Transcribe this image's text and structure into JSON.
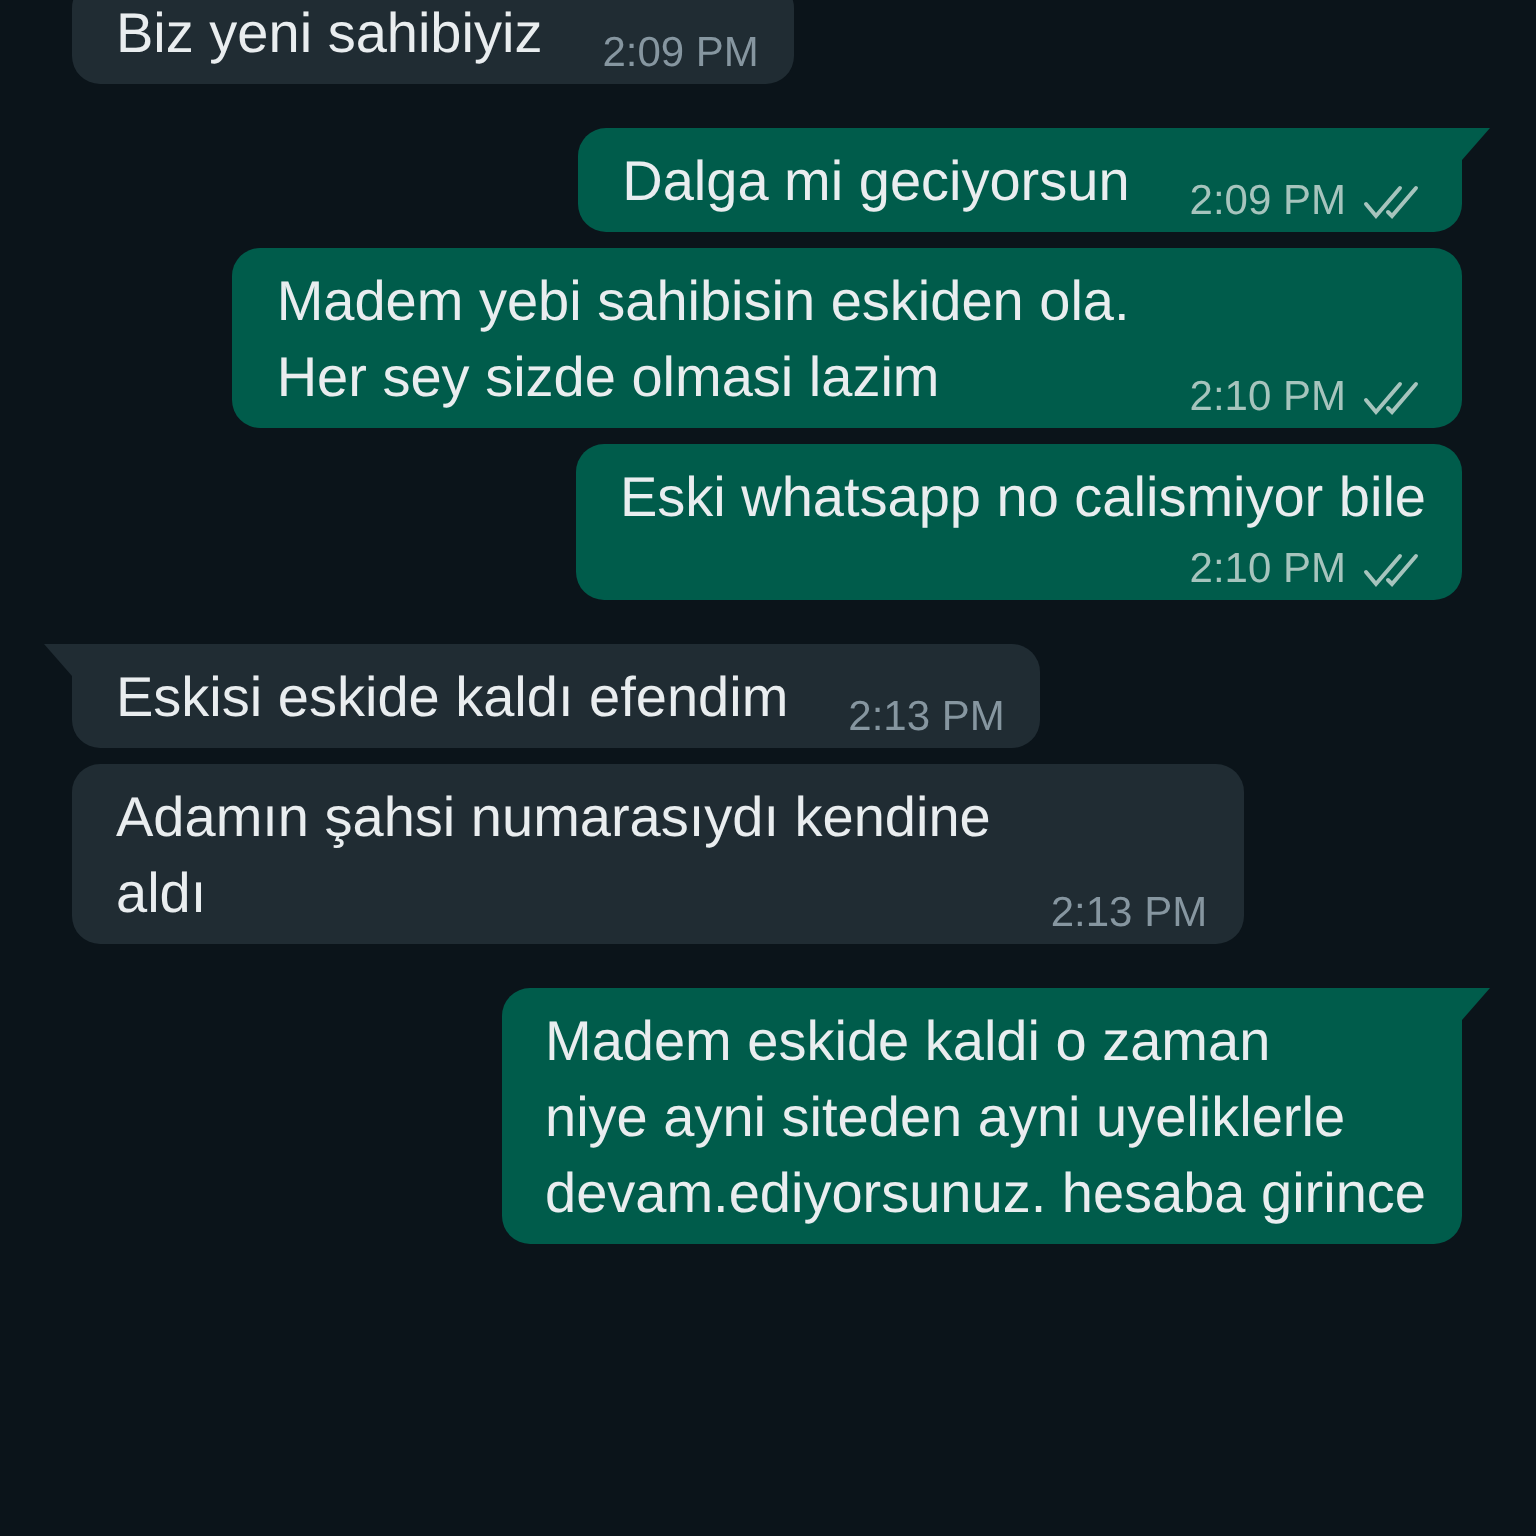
{
  "messages": [
    {
      "kind": "received",
      "tail": false,
      "lines": [
        "Biz yeni sahibiyiz"
      ],
      "time": "2:09 PM"
    },
    {
      "kind": "sent",
      "tail": true,
      "lines": [
        "Dalga mi geciyorsun"
      ],
      "time": "2:09 PM",
      "read": false
    },
    {
      "kind": "sent",
      "tail": false,
      "lines": [
        "Madem yebi sahibisin eskiden ola.",
        "Her sey sizde olmasi lazim"
      ],
      "time": "2:10 PM",
      "read": false
    },
    {
      "kind": "sent",
      "tail": false,
      "lines": [
        "Eski whatsapp no calismiyor bile"
      ],
      "time": "2:10 PM",
      "read": false,
      "meta_below": true
    },
    {
      "kind": "received",
      "tail": true,
      "lines": [
        "Eskisi eskide kaldı efendim"
      ],
      "time": "2:13 PM"
    },
    {
      "kind": "received",
      "tail": false,
      "lines": [
        "Adamın şahsi numarasıydı kendine",
        "aldı"
      ],
      "time": "2:13 PM"
    },
    {
      "kind": "sent",
      "tail": true,
      "lines": [
        "Madem eskide kaldi o zaman",
        "niye ayni siteden ayni uyeliklerle",
        "devam.ediyorsunuz. hesaba girince"
      ]
    }
  ]
}
